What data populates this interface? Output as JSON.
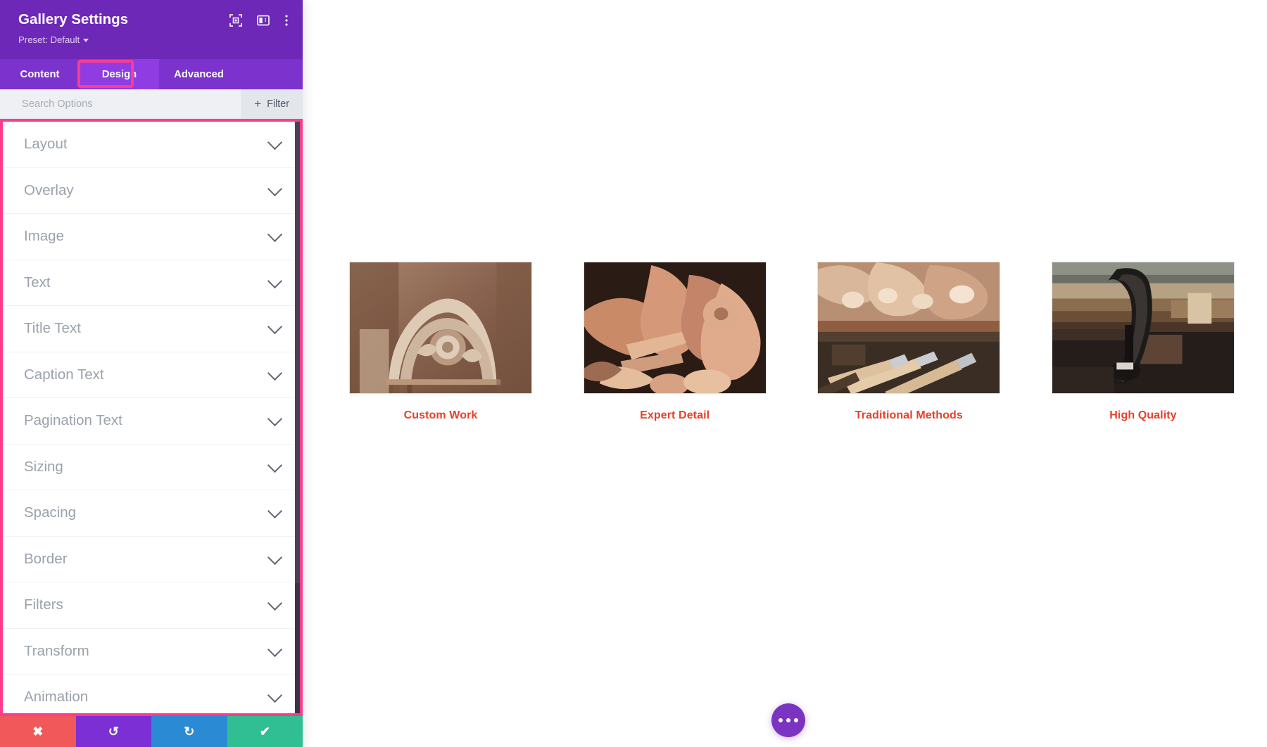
{
  "panel": {
    "title": "Gallery Settings",
    "preset_label": "Preset: Default",
    "header_icons": [
      {
        "name": "focus-target-icon",
        "title": "Focus"
      },
      {
        "name": "panel-layout-icon",
        "title": "Layout"
      },
      {
        "name": "vertical-dots-icon",
        "title": "More options"
      }
    ],
    "tabs": [
      {
        "id": "content",
        "label": "Content",
        "active": false
      },
      {
        "id": "design",
        "label": "Design",
        "active": true
      },
      {
        "id": "advanced",
        "label": "Advanced",
        "active": false
      }
    ],
    "search": {
      "placeholder": "Search Options",
      "value": ""
    },
    "filter_button": {
      "label": "Filter",
      "icon": "plus-icon"
    },
    "option_groups": [
      {
        "label": "Layout",
        "expanded": false
      },
      {
        "label": "Overlay",
        "expanded": false
      },
      {
        "label": "Image",
        "expanded": false
      },
      {
        "label": "Text",
        "expanded": false
      },
      {
        "label": "Title Text",
        "expanded": false
      },
      {
        "label": "Caption Text",
        "expanded": false
      },
      {
        "label": "Pagination Text",
        "expanded": false
      },
      {
        "label": "Sizing",
        "expanded": false
      },
      {
        "label": "Spacing",
        "expanded": false
      },
      {
        "label": "Border",
        "expanded": false
      },
      {
        "label": "Filters",
        "expanded": false
      },
      {
        "label": "Transform",
        "expanded": false
      },
      {
        "label": "Animation",
        "expanded": false
      }
    ],
    "actions": [
      {
        "id": "cancel",
        "icon": "close-icon",
        "glyph": "✖",
        "color": "#f0585a"
      },
      {
        "id": "undo",
        "icon": "undo-icon",
        "glyph": "↺",
        "color": "#7b2fd4"
      },
      {
        "id": "redo",
        "icon": "redo-icon",
        "glyph": "↻",
        "color": "#2a8ad4"
      },
      {
        "id": "save",
        "icon": "check-icon",
        "glyph": "✔",
        "color": "#2fbf92"
      }
    ]
  },
  "canvas": {
    "gallery": {
      "items": [
        {
          "caption": "Custom Work"
        },
        {
          "caption": "Expert Detail"
        },
        {
          "caption": "Traditional Methods"
        },
        {
          "caption": "High Quality"
        }
      ],
      "caption_color": "#e8402a"
    },
    "more_button": {
      "name": "page-settings-button",
      "color": "#7b33c1"
    }
  },
  "highlights": {
    "tab_highlight_color": "#ff3b8e",
    "options_highlight_color": "#ff3b8e"
  }
}
